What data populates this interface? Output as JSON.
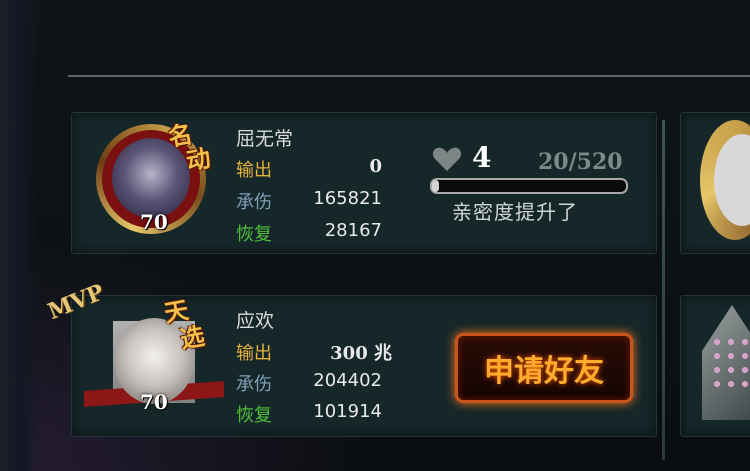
{
  "players": [
    {
      "name": "屈无常",
      "badge_top": "名",
      "badge_bottom": "动",
      "level": "70",
      "output_label": "输出",
      "output_value": "0",
      "taken_label": "承伤",
      "taken_value": "165821",
      "heal_label": "恢复",
      "heal_value": "28167"
    },
    {
      "name": "应欢",
      "badge_top": "天",
      "badge_bottom": "选",
      "level": "70",
      "mvp": "MVP",
      "output_label": "输出",
      "output_value": "300 兆",
      "taken_label": "承伤",
      "taken_value": "204402",
      "heal_label": "恢复",
      "heal_value": "101914"
    }
  ],
  "intimacy": {
    "icon": "heart-icon",
    "count": "4",
    "progress": "20/520",
    "progress_fraction": 0.038,
    "message": "亲密度提升了"
  },
  "friend_button": {
    "label": "申请好友",
    "accent": "#ff7a1a"
  }
}
